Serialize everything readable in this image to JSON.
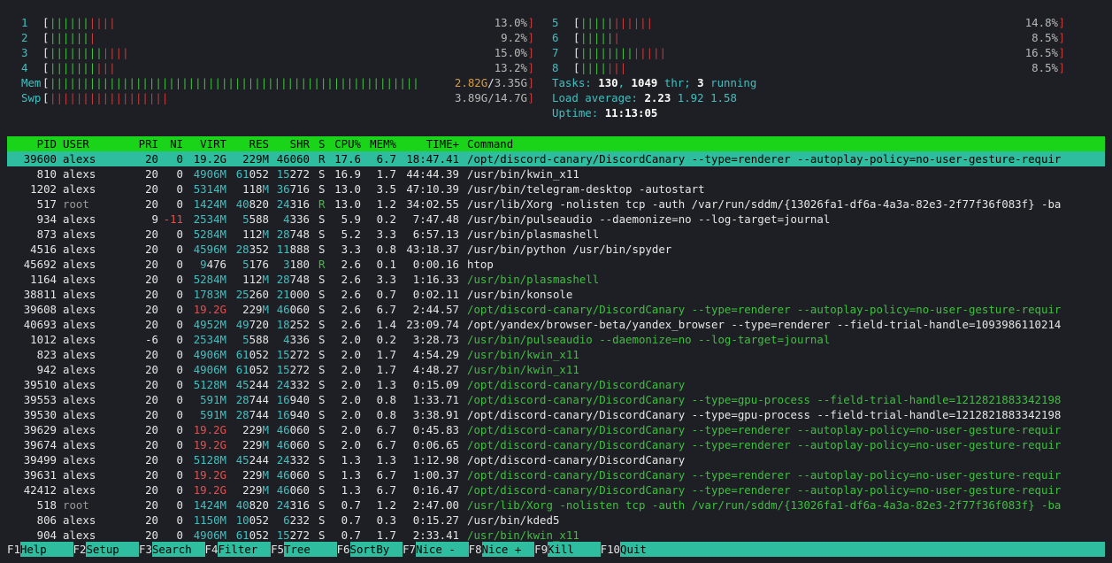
{
  "cpus": [
    {
      "id": "1",
      "green": 6,
      "red": 4,
      "pct": "13.0%"
    },
    {
      "id": "2",
      "green": 6,
      "red": 1,
      "pct": "9.2%"
    },
    {
      "id": "3",
      "green": 8,
      "red": 4,
      "pct": "15.0%"
    },
    {
      "id": "4",
      "green": 7,
      "red": 3,
      "pct": "13.2%"
    },
    {
      "id": "5",
      "green": 5,
      "red": 6,
      "pct": "14.8%"
    },
    {
      "id": "6",
      "green": 5,
      "red": 1,
      "pct": "8.5%"
    },
    {
      "id": "7",
      "green": 8,
      "red": 5,
      "pct": "16.5%"
    },
    {
      "id": "8",
      "green": 4,
      "red": 3,
      "pct": "8.5%"
    }
  ],
  "mem": {
    "label": "Mem",
    "used": "2.82G",
    "total": "3.35G",
    "fill_green": 56
  },
  "swp": {
    "label": "Swp",
    "text": "3.89G/14.7G",
    "fill_red": 18
  },
  "tasks": {
    "label": "Tasks:",
    "count": "130",
    "thr": "1049",
    "thr_label": "thr;",
    "running": "3",
    "running_label": "running"
  },
  "load": {
    "label": "Load average:",
    "l1": "2.23",
    "l5": "1.92",
    "l15": "1.58"
  },
  "uptime": {
    "label": "Uptime:",
    "value": "11:13:05"
  },
  "columns": {
    "pid": "PID",
    "user": "USER",
    "pri": "PRI",
    "ni": "NI",
    "virt": "VIRT",
    "res": "RES",
    "shr": "SHR",
    "s": "S",
    "cpu": "CPU%",
    "mem": "MEM%",
    "time": "TIME+",
    "cmd": "Command"
  },
  "processes": [
    {
      "pid": "39600",
      "user": "alexs",
      "pri": "20",
      "ni": "0",
      "virt": "19.2G",
      "res": "229M",
      "shr": "46060",
      "s": "R",
      "cpu": "17.6",
      "mem": "6.7",
      "time": "18:47.41",
      "cmd": "/opt/discord-canary/DiscordCanary --type=renderer --autoplay-policy=no-user-gesture-requir",
      "sel": true
    },
    {
      "pid": "810",
      "user": "alexs",
      "pri": "20",
      "ni": "0",
      "virt": "4906M",
      "res": "61052",
      "shr": "15272",
      "s": "S",
      "cpu": "16.9",
      "mem": "1.7",
      "time": "44:44.39",
      "cmd": "/usr/bin/kwin_x11"
    },
    {
      "pid": "1202",
      "user": "alexs",
      "pri": "20",
      "ni": "0",
      "virt": "5314M",
      "res": "118M",
      "shr": "36716",
      "s": "S",
      "cpu": "13.0",
      "mem": "3.5",
      "time": "47:10.39",
      "cmd": "/usr/bin/telegram-desktop -autostart"
    },
    {
      "pid": "517",
      "user": "root",
      "pri": "20",
      "ni": "0",
      "virt": "1424M",
      "res": "40820",
      "shr": "24316",
      "s": "R",
      "cpu": "13.0",
      "mem": "1.2",
      "time": "34:02.55",
      "cmd": "/usr/lib/Xorg -nolisten tcp -auth /var/run/sddm/{13026fa1-df6a-4a3a-82e3-2f77f36f083f} -ba"
    },
    {
      "pid": "934",
      "user": "alexs",
      "pri": "9",
      "ni": "-11",
      "virt": "2534M",
      "res": "5588",
      "shr": "4336",
      "s": "S",
      "cpu": "5.9",
      "mem": "0.2",
      "time": "7:47.48",
      "cmd": "/usr/bin/pulseaudio --daemonize=no --log-target=journal"
    },
    {
      "pid": "873",
      "user": "alexs",
      "pri": "20",
      "ni": "0",
      "virt": "5284M",
      "res": "112M",
      "shr": "28748",
      "s": "S",
      "cpu": "5.2",
      "mem": "3.3",
      "time": "6:57.13",
      "cmd": "/usr/bin/plasmashell"
    },
    {
      "pid": "4516",
      "user": "alexs",
      "pri": "20",
      "ni": "0",
      "virt": "4596M",
      "res": "28352",
      "shr": "11888",
      "s": "S",
      "cpu": "3.3",
      "mem": "0.8",
      "time": "43:18.37",
      "cmd": "/usr/bin/python /usr/bin/spyder"
    },
    {
      "pid": "45692",
      "user": "alexs",
      "pri": "20",
      "ni": "0",
      "virt": "9476",
      "res": "5176",
      "shr": "3180",
      "s": "R",
      "cpu": "2.6",
      "mem": "0.1",
      "time": "0:00.16",
      "cmd": "htop"
    },
    {
      "pid": "1164",
      "user": "alexs",
      "pri": "20",
      "ni": "0",
      "virt": "5284M",
      "res": "112M",
      "shr": "28748",
      "s": "S",
      "cpu": "2.6",
      "mem": "3.3",
      "time": "1:16.33",
      "cmd": "/usr/bin/plasmashell",
      "thread": true
    },
    {
      "pid": "38811",
      "user": "alexs",
      "pri": "20",
      "ni": "0",
      "virt": "1783M",
      "res": "25260",
      "shr": "21000",
      "s": "S",
      "cpu": "2.6",
      "mem": "0.7",
      "time": "0:02.11",
      "cmd": "/usr/bin/konsole"
    },
    {
      "pid": "39608",
      "user": "alexs",
      "pri": "20",
      "ni": "0",
      "virt": "19.2G",
      "res": "229M",
      "shr": "46060",
      "s": "S",
      "cpu": "2.6",
      "mem": "6.7",
      "time": "2:44.57",
      "cmd": "/opt/discord-canary/DiscordCanary --type=renderer --autoplay-policy=no-user-gesture-requir",
      "thread": true
    },
    {
      "pid": "40693",
      "user": "alexs",
      "pri": "20",
      "ni": "0",
      "virt": "4952M",
      "res": "49720",
      "shr": "18252",
      "s": "S",
      "cpu": "2.6",
      "mem": "1.4",
      "time": "23:09.74",
      "cmd": "/opt/yandex/browser-beta/yandex_browser --type=renderer --field-trial-handle=1093986110214"
    },
    {
      "pid": "1012",
      "user": "alexs",
      "pri": "-6",
      "ni": "0",
      "virt": "2534M",
      "res": "5588",
      "shr": "4336",
      "s": "S",
      "cpu": "2.0",
      "mem": "0.2",
      "time": "3:28.73",
      "cmd": "/usr/bin/pulseaudio --daemonize=no --log-target=journal",
      "thread": true
    },
    {
      "pid": "823",
      "user": "alexs",
      "pri": "20",
      "ni": "0",
      "virt": "4906M",
      "res": "61052",
      "shr": "15272",
      "s": "S",
      "cpu": "2.0",
      "mem": "1.7",
      "time": "4:54.29",
      "cmd": "/usr/bin/kwin_x11",
      "thread": true
    },
    {
      "pid": "942",
      "user": "alexs",
      "pri": "20",
      "ni": "0",
      "virt": "4906M",
      "res": "61052",
      "shr": "15272",
      "s": "S",
      "cpu": "2.0",
      "mem": "1.7",
      "time": "4:48.27",
      "cmd": "/usr/bin/kwin_x11",
      "thread": true
    },
    {
      "pid": "39510",
      "user": "alexs",
      "pri": "20",
      "ni": "0",
      "virt": "5128M",
      "res": "45244",
      "shr": "24332",
      "s": "S",
      "cpu": "2.0",
      "mem": "1.3",
      "time": "0:15.09",
      "cmd": "/opt/discord-canary/DiscordCanary",
      "thread": true
    },
    {
      "pid": "39553",
      "user": "alexs",
      "pri": "20",
      "ni": "0",
      "virt": "591M",
      "res": "28744",
      "shr": "16940",
      "s": "S",
      "cpu": "2.0",
      "mem": "0.8",
      "time": "1:33.71",
      "cmd": "/opt/discord-canary/DiscordCanary --type=gpu-process --field-trial-handle=1212821883342198",
      "thread": true
    },
    {
      "pid": "39530",
      "user": "alexs",
      "pri": "20",
      "ni": "0",
      "virt": "591M",
      "res": "28744",
      "shr": "16940",
      "s": "S",
      "cpu": "2.0",
      "mem": "0.8",
      "time": "3:38.91",
      "cmd": "/opt/discord-canary/DiscordCanary --type=gpu-process --field-trial-handle=1212821883342198"
    },
    {
      "pid": "39629",
      "user": "alexs",
      "pri": "20",
      "ni": "0",
      "virt": "19.2G",
      "res": "229M",
      "shr": "46060",
      "s": "S",
      "cpu": "2.0",
      "mem": "6.7",
      "time": "0:45.83",
      "cmd": "/opt/discord-canary/DiscordCanary --type=renderer --autoplay-policy=no-user-gesture-requir",
      "thread": true
    },
    {
      "pid": "39674",
      "user": "alexs",
      "pri": "20",
      "ni": "0",
      "virt": "19.2G",
      "res": "229M",
      "shr": "46060",
      "s": "S",
      "cpu": "2.0",
      "mem": "6.7",
      "time": "0:06.65",
      "cmd": "/opt/discord-canary/DiscordCanary --type=renderer --autoplay-policy=no-user-gesture-requir",
      "thread": true
    },
    {
      "pid": "39499",
      "user": "alexs",
      "pri": "20",
      "ni": "0",
      "virt": "5128M",
      "res": "45244",
      "shr": "24332",
      "s": "S",
      "cpu": "1.3",
      "mem": "1.3",
      "time": "1:12.98",
      "cmd": "/opt/discord-canary/DiscordCanary"
    },
    {
      "pid": "39631",
      "user": "alexs",
      "pri": "20",
      "ni": "0",
      "virt": "19.2G",
      "res": "229M",
      "shr": "46060",
      "s": "S",
      "cpu": "1.3",
      "mem": "6.7",
      "time": "1:00.37",
      "cmd": "/opt/discord-canary/DiscordCanary --type=renderer --autoplay-policy=no-user-gesture-requir",
      "thread": true
    },
    {
      "pid": "42412",
      "user": "alexs",
      "pri": "20",
      "ni": "0",
      "virt": "19.2G",
      "res": "229M",
      "shr": "46060",
      "s": "S",
      "cpu": "1.3",
      "mem": "6.7",
      "time": "0:16.47",
      "cmd": "/opt/discord-canary/DiscordCanary --type=renderer --autoplay-policy=no-user-gesture-requir",
      "thread": true
    },
    {
      "pid": "518",
      "user": "root",
      "pri": "20",
      "ni": "0",
      "virt": "1424M",
      "res": "40820",
      "shr": "24316",
      "s": "S",
      "cpu": "0.7",
      "mem": "1.2",
      "time": "2:47.00",
      "cmd": "/usr/lib/Xorg -nolisten tcp -auth /var/run/sddm/{13026fa1-df6a-4a3a-82e3-2f77f36f083f} -ba",
      "thread": true
    },
    {
      "pid": "806",
      "user": "alexs",
      "pri": "20",
      "ni": "0",
      "virt": "1150M",
      "res": "10052",
      "shr": "6232",
      "s": "S",
      "cpu": "0.7",
      "mem": "0.3",
      "time": "0:15.27",
      "cmd": "/usr/bin/kded5"
    },
    {
      "pid": "904",
      "user": "alexs",
      "pri": "20",
      "ni": "0",
      "virt": "4906M",
      "res": "61052",
      "shr": "15272",
      "s": "S",
      "cpu": "0.7",
      "mem": "1.7",
      "time": "2:33.41",
      "cmd": "/usr/bin/kwin_x11",
      "thread": true
    }
  ],
  "footer": [
    {
      "key": "F1",
      "label": "Help"
    },
    {
      "key": "F2",
      "label": "Setup"
    },
    {
      "key": "F3",
      "label": "Search"
    },
    {
      "key": "F4",
      "label": "Filter"
    },
    {
      "key": "F5",
      "label": "Tree"
    },
    {
      "key": "F6",
      "label": "SortBy"
    },
    {
      "key": "F7",
      "label": "Nice -"
    },
    {
      "key": "F8",
      "label": "Nice +"
    },
    {
      "key": "F9",
      "label": "Kill"
    },
    {
      "key": "F10",
      "label": "Quit"
    }
  ],
  "colors": {
    "bg": "#1e1f24",
    "header_bg": "#19d419",
    "selected_bg": "#2ebd9f",
    "cyan": "#3ec1c1",
    "green": "#3fbf3f",
    "red": "#c43b3b"
  }
}
